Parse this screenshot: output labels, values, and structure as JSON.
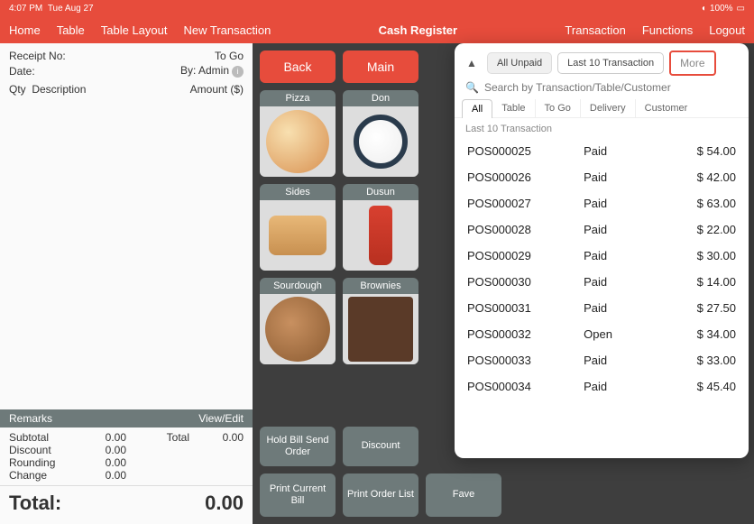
{
  "status": {
    "time": "4:07 PM",
    "date": "Tue Aug 27",
    "battery": "100%"
  },
  "header": {
    "left": [
      "Home",
      "Table",
      "Table Layout",
      "New Transaction"
    ],
    "center": "Cash Register",
    "right": [
      "Transaction",
      "Functions",
      "Logout"
    ]
  },
  "receipt": {
    "no_label": "Receipt No:",
    "type": "To Go",
    "date_label": "Date:",
    "by_label": "By: Admin",
    "qty_label": "Qty",
    "desc_label": "Description",
    "amt_label": "Amount ($)",
    "remarks": "Remarks",
    "viewedit": "View/Edit",
    "subtotal_label": "Subtotal",
    "subtotal": "0.00",
    "discount_label": "Discount",
    "discount": "0.00",
    "rounding_label": "Rounding",
    "rounding": "0.00",
    "change_label": "Change",
    "change": "0.00",
    "total_label": "Total",
    "total_val": "0.00",
    "grand_label": "Total:",
    "grand_val": "0.00"
  },
  "buttons": {
    "back": "Back",
    "main": "Main",
    "hold": "Hold Bill Send Order",
    "discount": "Discount",
    "printcurrent": "Print Current Bill",
    "printorder": "Print Order List",
    "fave": "Fave"
  },
  "categories": [
    "Pizza",
    "Don",
    "Sides",
    "Dusun",
    "Sourdough",
    "Brownies"
  ],
  "panel": {
    "seg1": "All Unpaid",
    "seg2": "Last 10 Transaction",
    "more": "More",
    "search_placeholder": "Search by Transaction/Table/Customer",
    "tabs": [
      "All",
      "Table",
      "To Go",
      "Delivery",
      "Customer"
    ],
    "section": "Last 10 Transaction",
    "rows": [
      {
        "id": "POS000025",
        "status": "Paid",
        "amt": "$ 54.00"
      },
      {
        "id": "POS000026",
        "status": "Paid",
        "amt": "$ 42.00"
      },
      {
        "id": "POS000027",
        "status": "Paid",
        "amt": "$ 63.00"
      },
      {
        "id": "POS000028",
        "status": "Paid",
        "amt": "$ 22.00"
      },
      {
        "id": "POS000029",
        "status": "Paid",
        "amt": "$ 30.00"
      },
      {
        "id": "POS000030",
        "status": "Paid",
        "amt": "$ 14.00"
      },
      {
        "id": "POS000031",
        "status": "Paid",
        "amt": "$ 27.50"
      },
      {
        "id": "POS000032",
        "status": "Open",
        "amt": "$ 34.00"
      },
      {
        "id": "POS000033",
        "status": "Paid",
        "amt": "$ 33.00"
      },
      {
        "id": "POS000034",
        "status": "Paid",
        "amt": "$ 45.40"
      }
    ]
  }
}
